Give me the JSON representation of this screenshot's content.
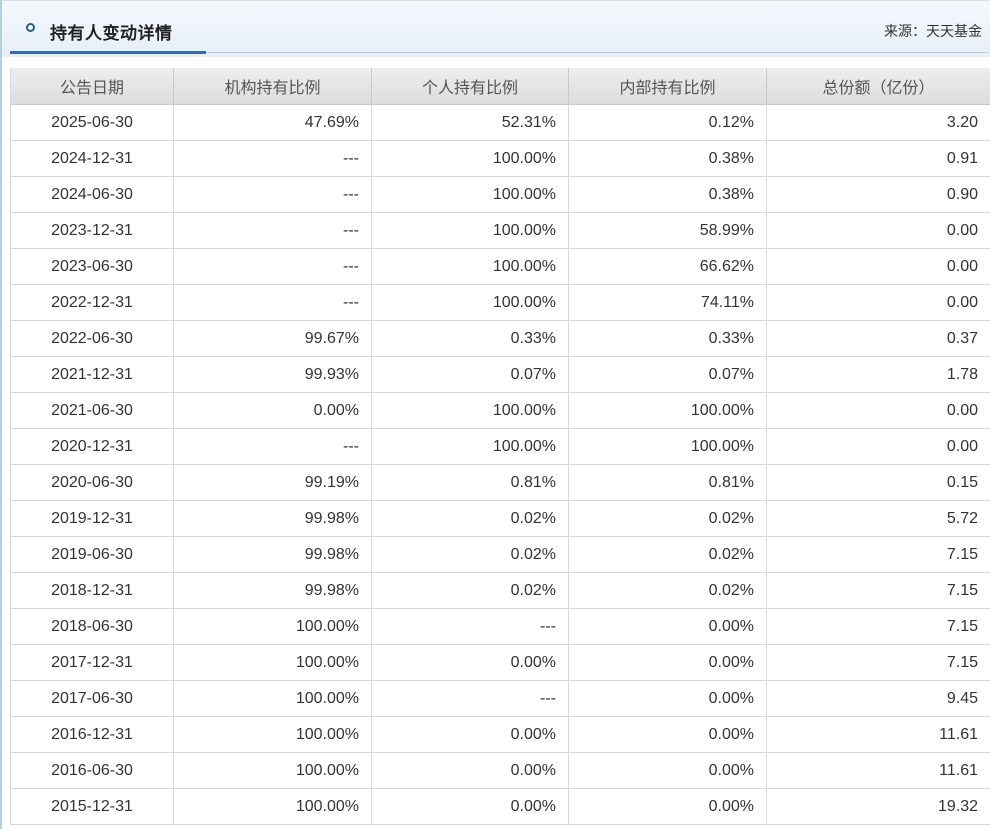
{
  "header": {
    "title": "持有人变动详情",
    "source": "来源：天天基金",
    "icon": "circle-icon"
  },
  "table": {
    "columns": [
      "公告日期",
      "机构持有比例",
      "个人持有比例",
      "内部持有比例",
      "总份额（亿份）"
    ],
    "rows": [
      [
        "2025-06-30",
        "47.69%",
        "52.31%",
        "0.12%",
        "3.20"
      ],
      [
        "2024-12-31",
        "---",
        "100.00%",
        "0.38%",
        "0.91"
      ],
      [
        "2024-06-30",
        "---",
        "100.00%",
        "0.38%",
        "0.90"
      ],
      [
        "2023-12-31",
        "---",
        "100.00%",
        "58.99%",
        "0.00"
      ],
      [
        "2023-06-30",
        "---",
        "100.00%",
        "66.62%",
        "0.00"
      ],
      [
        "2022-12-31",
        "---",
        "100.00%",
        "74.11%",
        "0.00"
      ],
      [
        "2022-06-30",
        "99.67%",
        "0.33%",
        "0.33%",
        "0.37"
      ],
      [
        "2021-12-31",
        "99.93%",
        "0.07%",
        "0.07%",
        "1.78"
      ],
      [
        "2021-06-30",
        "0.00%",
        "100.00%",
        "100.00%",
        "0.00"
      ],
      [
        "2020-12-31",
        "---",
        "100.00%",
        "100.00%",
        "0.00"
      ],
      [
        "2020-06-30",
        "99.19%",
        "0.81%",
        "0.81%",
        "0.15"
      ],
      [
        "2019-12-31",
        "99.98%",
        "0.02%",
        "0.02%",
        "5.72"
      ],
      [
        "2019-06-30",
        "99.98%",
        "0.02%",
        "0.02%",
        "7.15"
      ],
      [
        "2018-12-31",
        "99.98%",
        "0.02%",
        "0.02%",
        "7.15"
      ],
      [
        "2018-06-30",
        "100.00%",
        "---",
        "0.00%",
        "7.15"
      ],
      [
        "2017-12-31",
        "100.00%",
        "0.00%",
        "0.00%",
        "7.15"
      ],
      [
        "2017-06-30",
        "100.00%",
        "---",
        "0.00%",
        "9.45"
      ],
      [
        "2016-12-31",
        "100.00%",
        "0.00%",
        "0.00%",
        "11.61"
      ],
      [
        "2016-06-30",
        "100.00%",
        "0.00%",
        "0.00%",
        "11.61"
      ],
      [
        "2015-12-31",
        "100.00%",
        "0.00%",
        "0.00%",
        "19.32"
      ]
    ]
  }
}
